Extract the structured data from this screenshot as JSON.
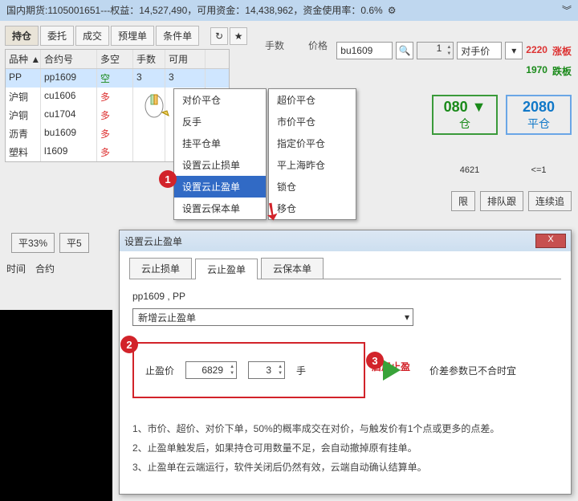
{
  "title": {
    "prefix": "国内期货:",
    "acct": "1105001651",
    "sep": "---",
    "eq_lbl": "权益：",
    "equity": "14,527,490",
    "avail_lbl": "，可用资金：",
    "avail": "14,438,962",
    "use_lbl": "，资金使用率：",
    "use": "0.6%"
  },
  "tabs": [
    "持仓",
    "委托",
    "成交",
    "预埋单",
    "条件单"
  ],
  "search": {
    "lbl_lots": "手数",
    "lbl_price": "价格",
    "symbol": "bu1609",
    "lots": "1",
    "price_mode": "对手价",
    "up_limit": "2220",
    "up_lbl": "涨板",
    "dn_limit": "1970",
    "dn_lbl": "跌板"
  },
  "big_buttons": {
    "buy_px": "080",
    "buy_lbl": "仓",
    "sell_px": "2080",
    "sell_lbl": "平仓",
    "left_under": "4621",
    "right_under": "<=1"
  },
  "action_btns": {
    "a": "限",
    "b": "排队跟",
    "c": "连续追"
  },
  "table": {
    "headers": [
      "品种 ▲",
      "合约号",
      "多空",
      "手数",
      "可用"
    ],
    "rows": [
      {
        "p": "PP",
        "c": "pp1609",
        "d": "空",
        "q": "3",
        "a": "3"
      },
      {
        "p": "沪铜",
        "c": "cu1606",
        "d": "多",
        "q": "",
        "a": ""
      },
      {
        "p": "沪铜",
        "c": "cu1704",
        "d": "多",
        "q": "",
        "a": ""
      },
      {
        "p": "沥青",
        "c": "bu1609",
        "d": "多",
        "q": "",
        "a": ""
      },
      {
        "p": "塑料",
        "c": "l1609",
        "d": "多",
        "q": "",
        "a": ""
      }
    ]
  },
  "menu1": [
    "对价平仓",
    "反手",
    "挂平仓单",
    "设置云止损单",
    "设置云止盈单",
    "设置云保本单"
  ],
  "menu1_sel": 4,
  "menu2": [
    "超价平仓",
    "市价平仓",
    "指定价平仓",
    "平上海昨仓",
    "锁仓",
    "移仓"
  ],
  "bottom_btns": [
    "平33%",
    "平5"
  ],
  "below_labels": {
    "time": "时间",
    "contract": "合约"
  },
  "dlg": {
    "title": "设置云止盈单",
    "tabs": [
      "云止损单",
      "云止盈单",
      "云保本单"
    ],
    "active": 1,
    "symline": "pp1609 , PP",
    "combo": "新增云止盈单",
    "stop_lbl": "止盈价",
    "stop_val": "6829",
    "qty_val": "3",
    "qty_lbl": "手",
    "enable": "启用止盈",
    "spread": "价差参数已不合时宜",
    "notes": [
      "1、市价、超价、对价下单，50%的概率成交在对价，与触发价有1个点或更多的点差。",
      "2、止盈单触发后，如果持仓可用数量不足，会自动撤掉原有挂单。",
      "3、止盈单在云端运行，软件关闭后仍然有效，云端自动确认结算单。"
    ]
  },
  "marks": {
    "1": "1",
    "2": "2",
    "3": "3"
  }
}
